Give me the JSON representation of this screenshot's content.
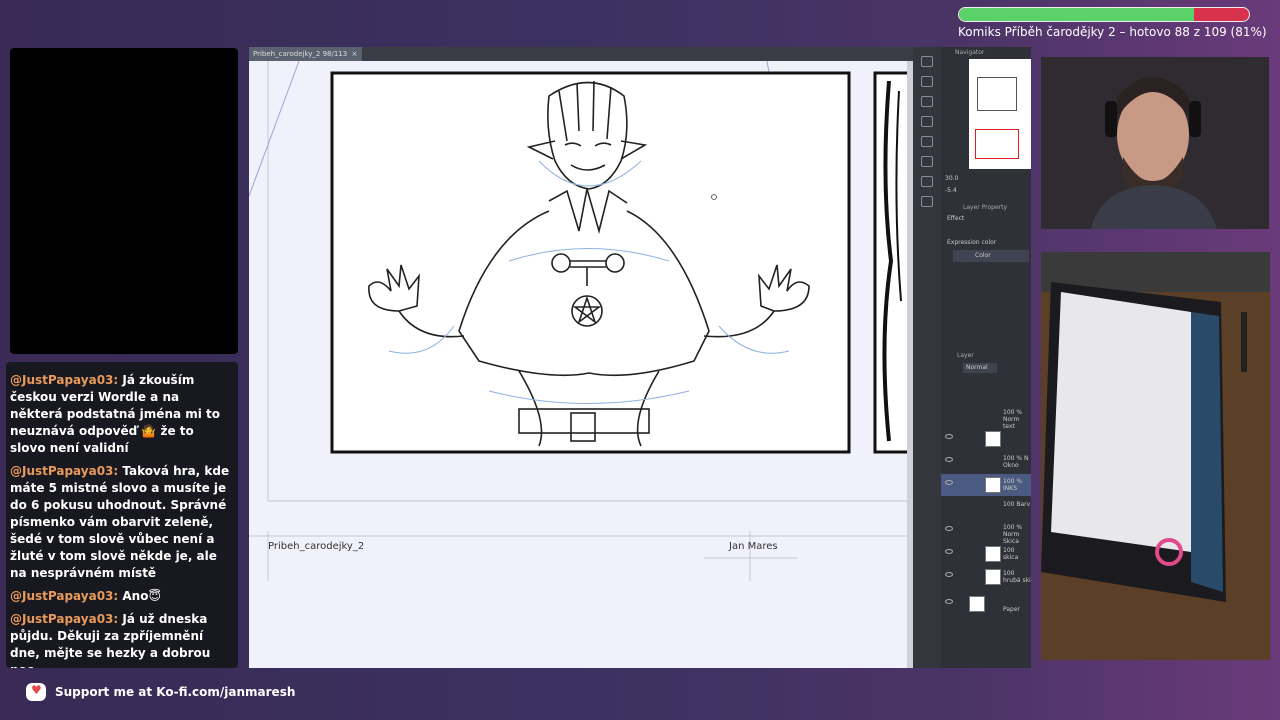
{
  "progress": {
    "text": "Komiks Příběh čarodějky 2 – hotovo 88 z 109 (81%)",
    "fraction": 0.81,
    "fill_color": "#5bd16a",
    "remain_color": "#d9324e"
  },
  "chat": {
    "messages": [
      {
        "user": "@JustPapaya03:",
        "text": "Já zkouším českou verzi Wordle a na některá podstatná jména mi to neuznává odpověď 🤷 že to slovo není validní"
      },
      {
        "user": "@JustPapaya03:",
        "text": "Taková hra, kde máte 5 mistné slovo a musíte je do 6 pokusu uhodnout. Správné písmenko vám obarvit zeleně, šedé v tom slově vůbec není a žluté v tom slově někde je, ale na nesprávném místě"
      },
      {
        "user": "@JustPapaya03:",
        "text": "Ano😇"
      },
      {
        "user": "@JustPapaya03:",
        "text": "Já už dneska půjdu. Děkuji za zpříjemnění dne, mějte se hezky a dobrou noc"
      }
    ]
  },
  "app": {
    "tab_label": "Pribeh_carodejky_2 98/113",
    "page_left_label": "Pribeh_carodejky_2",
    "page_right_label": "Jan Mares",
    "navigator": {
      "title": "Navigator",
      "zoom": "30.0",
      "angle": "-5.4"
    },
    "layer_property": {
      "title": "Layer Property",
      "effect": "Effect",
      "expression_color": "Expression color",
      "color_value": "Color"
    },
    "layer_panel": {
      "title": "Layer",
      "blend_mode": "Normal",
      "layers": [
        {
          "name": "100 % Norm text"
        },
        {
          "name": ""
        },
        {
          "name": "100 % N Okno"
        },
        {
          "name": "100 % INKS"
        },
        {
          "name": "100 Barv"
        },
        {
          "name": "100 % Norm Skica"
        },
        {
          "name": "100 skica"
        },
        {
          "name": "100 hrubá ski"
        },
        {
          "name": "Paper"
        }
      ]
    }
  },
  "footer": {
    "text": "Support me at Ko-fi.com/janmaresh"
  }
}
